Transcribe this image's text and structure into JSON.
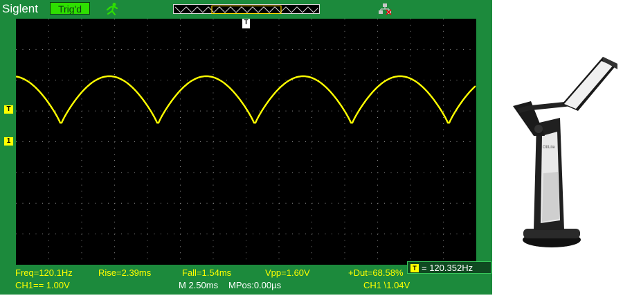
{
  "header": {
    "brand": "Siglent",
    "trigger_status": "Trig'd"
  },
  "markers": {
    "trigger_position": "T",
    "trigger_level": "T",
    "channel1": "1"
  },
  "readout": {
    "trigger_icon": "T",
    "frequency": "= 120.352Hz"
  },
  "measurements": {
    "freq": "Freq=120.1Hz",
    "rise": "Rise=2.39ms",
    "fall": "Fall=1.54ms",
    "vpp": "Vpp=1.60V",
    "duty": "+Dut=68.58%"
  },
  "status": {
    "ch1_scale": "CH1== 1.00V",
    "timebase": "M 2.50ms",
    "mpos": "MPos:0.00µs",
    "trigger": "CH1 \\1.04V"
  },
  "colors": {
    "trace": "#ffff00",
    "bezel": "#1c8a3c",
    "screen": "#000000",
    "grid": "#8a8a8a"
  },
  "icons": {
    "run": "running-figure-icon",
    "usb": "usb-network-icon",
    "lamp": "desk-lamp-photo"
  }
}
